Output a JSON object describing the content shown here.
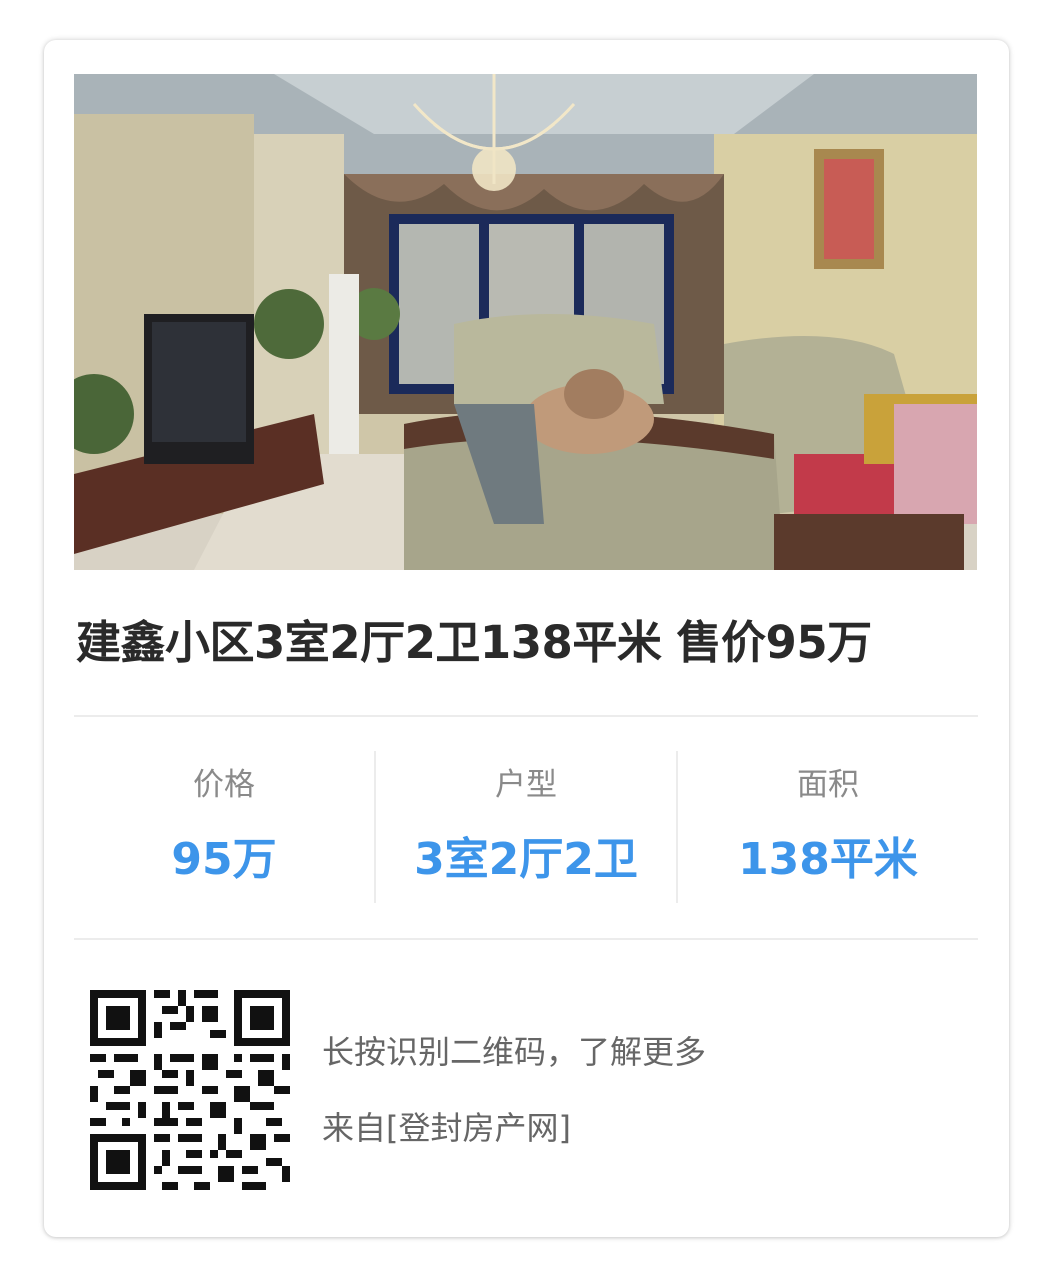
{
  "listing": {
    "photo_label": "living-room-photo",
    "title": "建鑫小区3室2厅2卫138平米 售价95万"
  },
  "stats": [
    {
      "label": "价格",
      "value": "95万"
    },
    {
      "label": "户型",
      "value": "3室2厅2卫"
    },
    {
      "label": "面积",
      "value": "138平米"
    }
  ],
  "footer": {
    "qr_icon": "qr-code-icon",
    "hint": "长按识别二维码，了解更多",
    "source": "来自[登封房产网]"
  },
  "colors": {
    "accent": "#3d95ea",
    "title": "#2a2a2a",
    "muted": "#8a8a8a",
    "footer_text": "#666666"
  }
}
